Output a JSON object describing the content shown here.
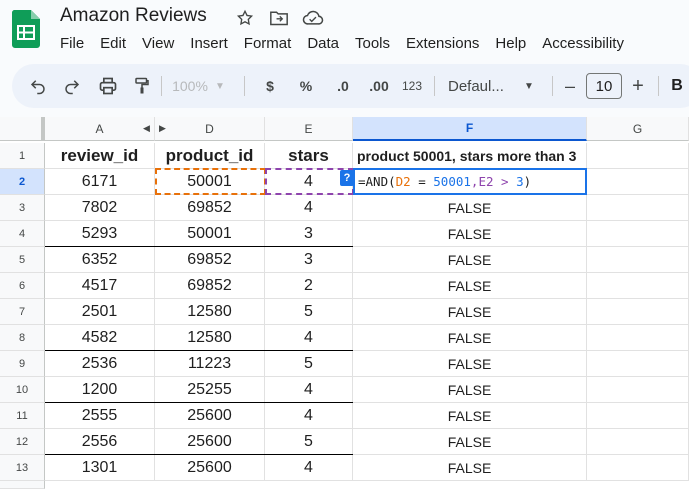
{
  "app": {
    "title": "Amazon Reviews",
    "menu": [
      "File",
      "Edit",
      "View",
      "Insert",
      "Format",
      "Data",
      "Tools",
      "Extensions",
      "Help",
      "Accessibility"
    ]
  },
  "toolbar": {
    "zoom": "100%",
    "currency": "$",
    "percent": "%",
    "decrease_decimal": ".0",
    "increase_decimal": ".00",
    "number_format": "123",
    "font": "Defaul...",
    "minus": "–",
    "font_size": "10",
    "plus": "+",
    "bold": "B"
  },
  "columns": [
    "A",
    "D",
    "E",
    "F",
    "G"
  ],
  "row_numbers": [
    "1",
    "2",
    "3",
    "4",
    "5",
    "6",
    "7",
    "8",
    "9",
    "10",
    "11",
    "12",
    "13"
  ],
  "headers": {
    "review_id": "review_id",
    "product_id": "product_id",
    "stars": "stars",
    "f_header": "product 50001, stars more than 3"
  },
  "rows": [
    {
      "review_id": "6171",
      "product_id": "50001",
      "stars": "4",
      "f": ""
    },
    {
      "review_id": "7802",
      "product_id": "69852",
      "stars": "4",
      "f": "FALSE"
    },
    {
      "review_id": "5293",
      "product_id": "50001",
      "stars": "3",
      "f": "FALSE"
    },
    {
      "review_id": "6352",
      "product_id": "69852",
      "stars": "3",
      "f": "FALSE"
    },
    {
      "review_id": "4517",
      "product_id": "69852",
      "stars": "2",
      "f": "FALSE"
    },
    {
      "review_id": "2501",
      "product_id": "12580",
      "stars": "5",
      "f": "FALSE"
    },
    {
      "review_id": "4582",
      "product_id": "12580",
      "stars": "4",
      "f": "FALSE"
    },
    {
      "review_id": "2536",
      "product_id": "11223",
      "stars": "5",
      "f": "FALSE"
    },
    {
      "review_id": "1200",
      "product_id": "25255",
      "stars": "4",
      "f": "FALSE"
    },
    {
      "review_id": "2555",
      "product_id": "25600",
      "stars": "4",
      "f": "FALSE"
    },
    {
      "review_id": "2556",
      "product_id": "25600",
      "stars": "5",
      "f": "FALSE"
    },
    {
      "review_id": "1301",
      "product_id": "25600",
      "stars": "4",
      "f": "FALSE"
    }
  ],
  "formula": {
    "help_badge": "?",
    "p1": "=AND(",
    "ref1": "D2",
    "p2": " = ",
    "num1": "50001",
    "p3": ",E2 > ",
    "num2": "3",
    "p4": ")"
  },
  "colors": {
    "accent": "#0b57d0",
    "ref_orange": "#e8710a",
    "ref_purple": "#8e44ad",
    "logo_green": "#0f9d58"
  }
}
